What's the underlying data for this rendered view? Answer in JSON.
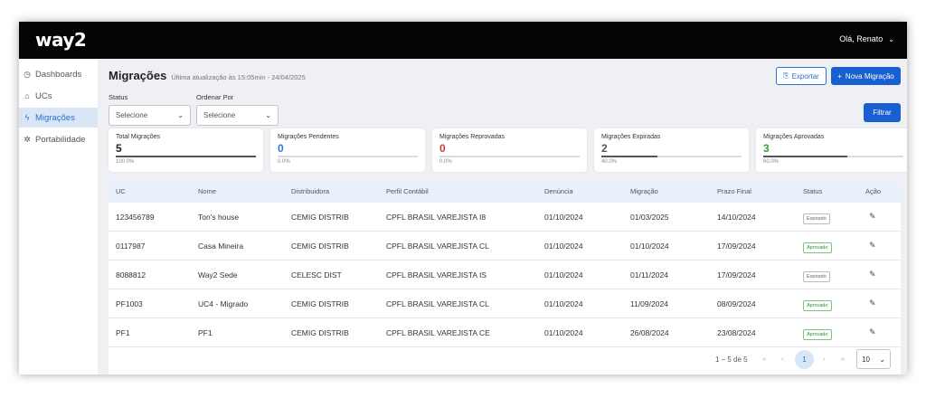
{
  "topbar": {
    "logo": "way2",
    "greeting": "Olá, Renato"
  },
  "sidebar": {
    "items": [
      {
        "label": "Dashboards",
        "icon": "gauge-icon"
      },
      {
        "label": "UCs",
        "icon": "home-icon"
      },
      {
        "label": "Migrações",
        "icon": "bolt-icon",
        "active": true
      },
      {
        "label": "Portabilidade",
        "icon": "sparkle-icon"
      }
    ]
  },
  "header": {
    "title": "Migrações",
    "last_update": "Última atualização às 15:05min - 24/04/2025",
    "export_label": "Exportar",
    "new_label": "Nova Migração",
    "filter_label": "Filtrar"
  },
  "filters": {
    "status": {
      "label": "Status",
      "value": "Selecione"
    },
    "order": {
      "label": "Ordenar Por",
      "value": "Selecione"
    }
  },
  "cards": [
    {
      "label": "Total Migrações",
      "value": "5",
      "percent": "100.0%",
      "fill": 1.0,
      "color": "#222222"
    },
    {
      "label": "Migrações Pendentes",
      "value": "0",
      "percent": "0.0%",
      "fill": 0.0,
      "color": "#2a7ad1"
    },
    {
      "label": "Migrações Reprovadas",
      "value": "0",
      "percent": "0.0%",
      "fill": 0.0,
      "color": "#d33a2f"
    },
    {
      "label": "Migrações Expiradas",
      "value": "2",
      "percent": "40.0%",
      "fill": 0.4,
      "color": "#555555"
    },
    {
      "label": "Migrações Aprovadas",
      "value": "3",
      "percent": "60.0%",
      "fill": 0.6,
      "color": "#3a9a3f"
    }
  ],
  "table": {
    "headers": [
      "UC",
      "Nome",
      "Distribuidora",
      "Perfil Contábil",
      "Denúncia",
      "Migração",
      "Prazo Final",
      "Status",
      "Ação"
    ],
    "rows": [
      {
        "uc": "123456789",
        "nome": "Ton's house",
        "dist": "CEMIG DISTRIB",
        "perfil": "CPFL BRASIL VAREJISTA I8",
        "denuncia": "01/10/2024",
        "migracao": "01/03/2025",
        "prazo": "14/10/2024",
        "status": "Expirado"
      },
      {
        "uc": "0117987",
        "nome": "Casa Mineira",
        "dist": "CEMIG DISTRIB",
        "perfil": "CPFL BRASIL VAREJISTA CL",
        "denuncia": "01/10/2024",
        "migracao": "01/10/2024",
        "prazo": "17/09/2024",
        "status": "Aprovado"
      },
      {
        "uc": "8088812",
        "nome": "Way2 Sede",
        "dist": "CELESC DIST",
        "perfil": "CPFL BRASIL VAREJISTA IS",
        "denuncia": "01/10/2024",
        "migracao": "01/11/2024",
        "prazo": "17/09/2024",
        "status": "Expirado"
      },
      {
        "uc": "PF1003",
        "nome": "UC4 - Migrado",
        "dist": "CEMIG DISTRIB",
        "perfil": "CPFL BRASIL VAREJISTA CL",
        "denuncia": "01/10/2024",
        "migracao": "11/09/2024",
        "prazo": "08/09/2024",
        "status": "Aprovado"
      },
      {
        "uc": "PF1",
        "nome": "PF1",
        "dist": "CEMIG DISTRIB",
        "perfil": "CPFL BRASIL VAREJISTA CE",
        "denuncia": "01/10/2024",
        "migracao": "26/08/2024",
        "prazo": "23/08/2024",
        "status": "Aprovado"
      }
    ]
  },
  "pagination": {
    "summary": "1 – 5 de 5",
    "current_page": "1",
    "page_size": "10"
  }
}
